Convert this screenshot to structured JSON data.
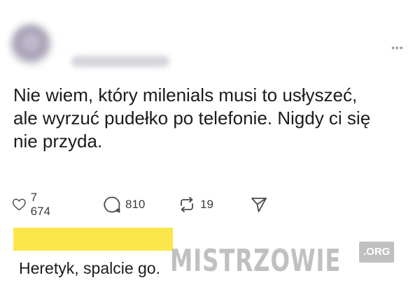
{
  "post": {
    "text": "Nie wiem, który milenials musi to usłyszeć, ale wyrzuć pudełko po telefonie. Nigdy ci się nie przyda."
  },
  "actions": {
    "likes": "7 674",
    "comments": "810",
    "reposts": "19"
  },
  "icons": {
    "like": "heart-icon",
    "comment": "comment-bubble-icon",
    "repost": "repost-icon",
    "share": "send-icon",
    "more": "more-dots-icon"
  },
  "reply": {
    "text": "Heretyk, spalcie go."
  },
  "watermark": {
    "main": "MISTRZOWIE",
    "tag": ".ORG"
  },
  "colors": {
    "highlight": "#fbe74a"
  }
}
